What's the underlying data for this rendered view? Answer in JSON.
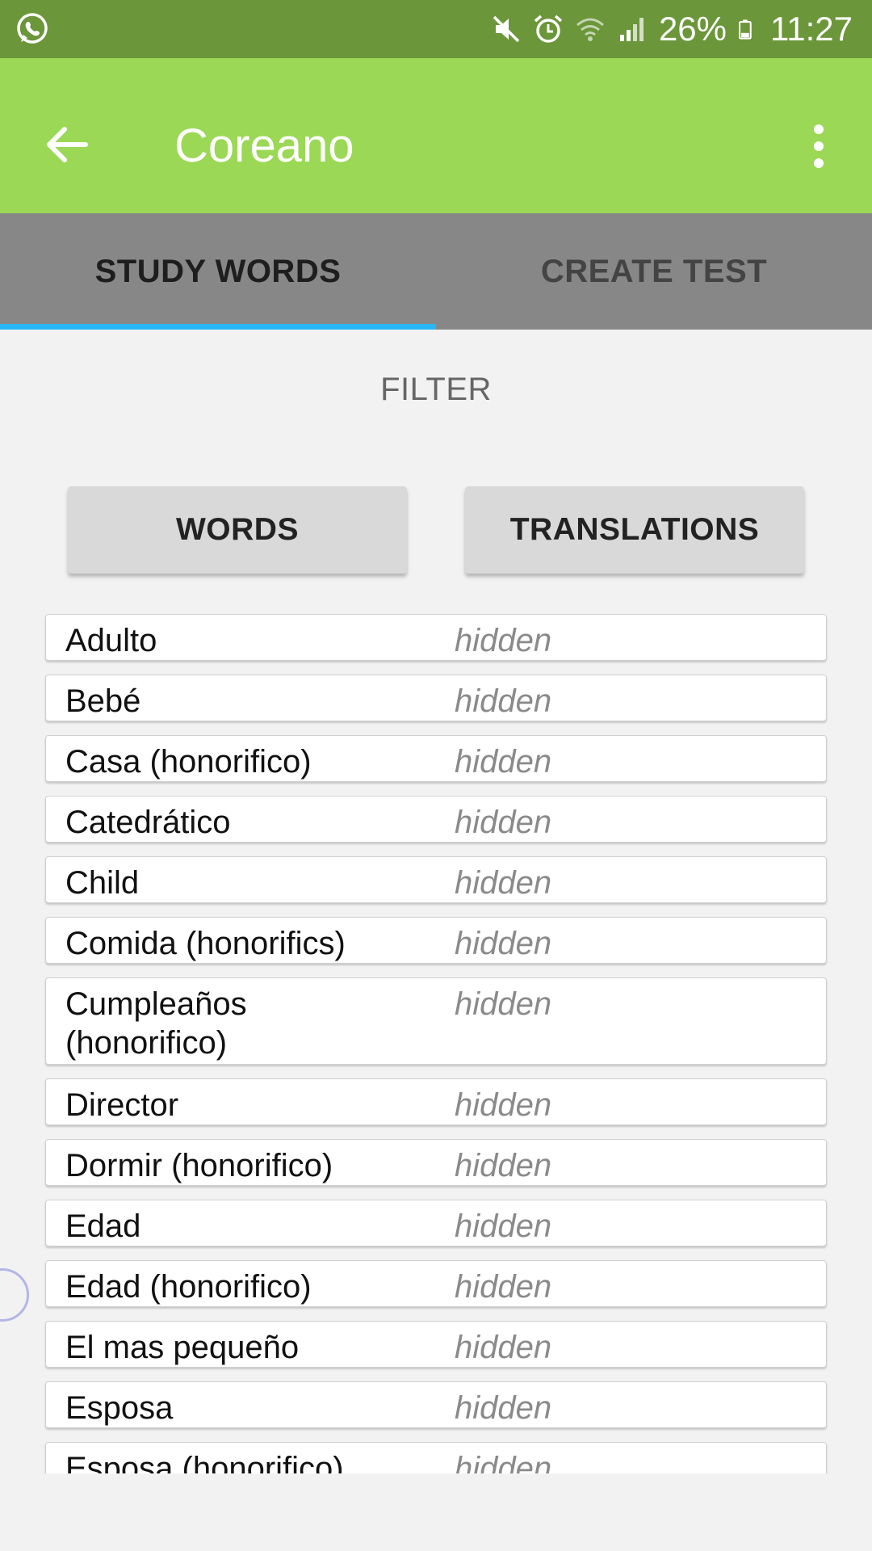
{
  "status_bar": {
    "battery": "26%",
    "time": "11:27",
    "icons": [
      "whatsapp-icon",
      "mute-icon",
      "alarm-icon",
      "wifi-icon",
      "signal-icon",
      "battery-icon"
    ]
  },
  "app_bar": {
    "title": "Coreano",
    "back_icon": "arrow-left-icon",
    "menu_icon": "more-vert-icon",
    "color": "#9bd855"
  },
  "tabs": [
    {
      "label": "STUDY WORDS",
      "active": true
    },
    {
      "label": "CREATE TEST",
      "active": false
    }
  ],
  "filter": {
    "label": "FILTER",
    "buttons": [
      "WORDS",
      "TRANSLATIONS"
    ]
  },
  "words": [
    {
      "word": "Adulto",
      "translation": "hidden"
    },
    {
      "word": "Bebé",
      "translation": "hidden"
    },
    {
      "word": "Casa (honorifico)",
      "translation": "hidden"
    },
    {
      "word": "Catedrático",
      "translation": "hidden"
    },
    {
      "word": "Child",
      "translation": "hidden"
    },
    {
      "word": "Comida (honorifics)",
      "translation": "hidden"
    },
    {
      "word": "Cumpleaños (honorifico)",
      "translation": "hidden"
    },
    {
      "word": "Director",
      "translation": "hidden"
    },
    {
      "word": "Dormir (honorifico)",
      "translation": "hidden"
    },
    {
      "word": "Edad",
      "translation": "hidden"
    },
    {
      "word": "Edad (honorifico)",
      "translation": "hidden"
    },
    {
      "word": "El mas pequeño",
      "translation": "hidden"
    },
    {
      "word": "Esposa",
      "translation": "hidden"
    },
    {
      "word": "Esposa (honorifico)",
      "translation": "hidden"
    }
  ]
}
